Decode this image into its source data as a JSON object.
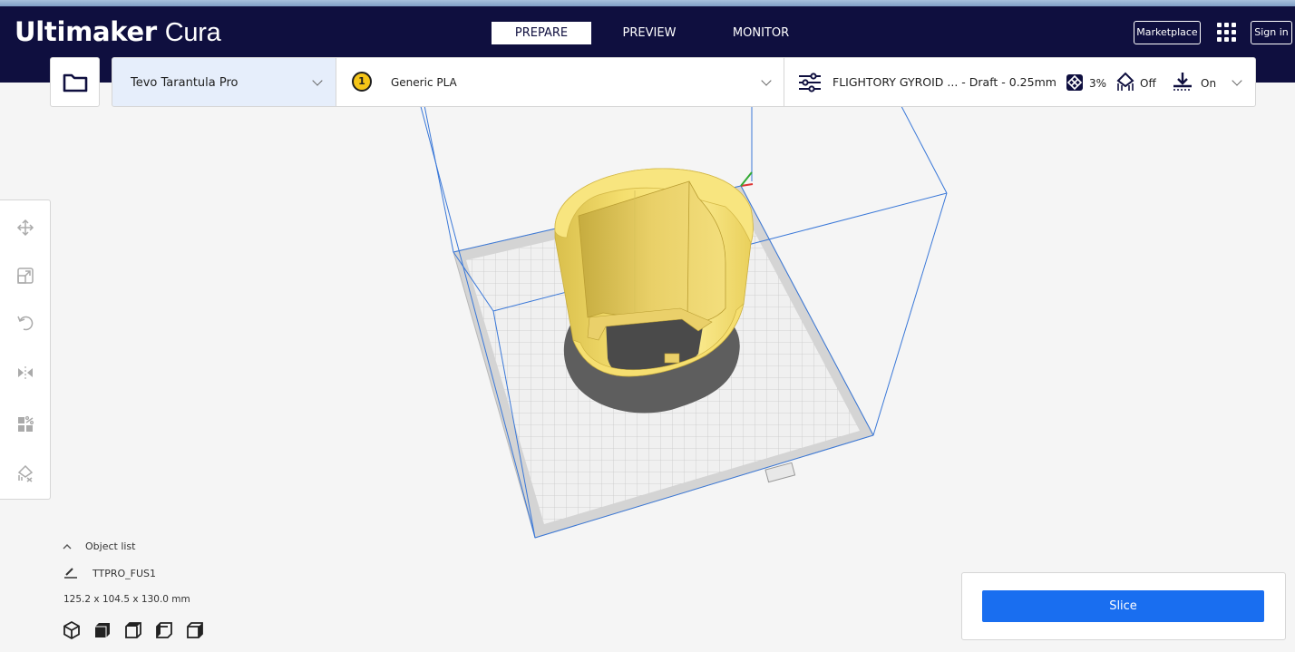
{
  "app": {
    "brand_bold": "Ultimaker",
    "brand_light": "Cura"
  },
  "header": {
    "tabs": [
      {
        "label": "PREPARE",
        "active": true
      },
      {
        "label": "PREVIEW",
        "active": false
      },
      {
        "label": "MONITOR",
        "active": false
      }
    ],
    "marketplace_label": "Marketplace",
    "apps_icon": "grid-icon",
    "signin_label": "Sign in"
  },
  "toolbar": {
    "open_icon": "folder-icon",
    "printer": "Tevo Tarantula Pro",
    "extruder_number": "1",
    "material": "Generic PLA",
    "profile": "FLIGHTORY GYROID ... - Draft - 0.25mm",
    "infill": "3%",
    "support": "Off",
    "adhesion": "On"
  },
  "side_tools": [
    "move-icon",
    "scale-icon",
    "rotate-icon",
    "mirror-icon",
    "per-model-settings-icon",
    "support-blocker-icon"
  ],
  "object_list": {
    "toggle_label": "Object list",
    "object_name": "TTPRO_FUS1",
    "dimensions": "125.2 x 104.5 x 130.0 mm",
    "view_icons": [
      "3d-view-icon",
      "front-view-icon",
      "top-view-icon",
      "left-view-icon",
      "right-view-icon"
    ]
  },
  "slice": {
    "button_label": "Slice"
  },
  "colors": {
    "header_bg": "#0f0f3f",
    "accent": "#196ef0",
    "model": "#f7e07a",
    "build_volume": "#3a78d8"
  }
}
